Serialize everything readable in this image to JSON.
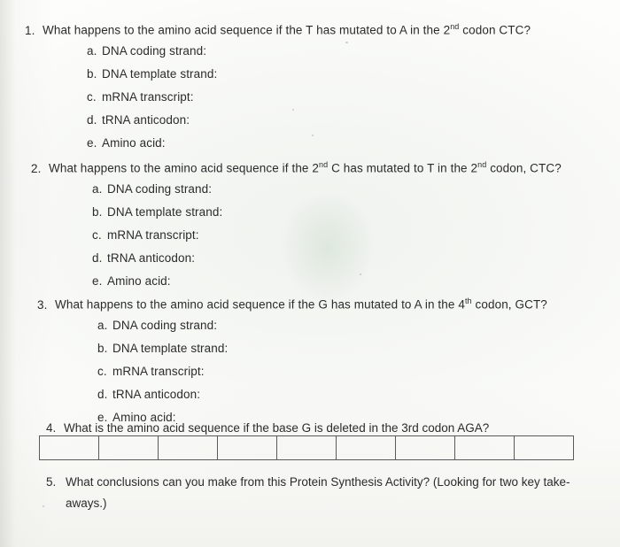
{
  "document": {
    "questions": [
      {
        "number": "1.",
        "text_parts": {
          "before": "What happens to the amino acid sequence if the T has mutated to A in the 2",
          "sup": "nd",
          "after": " codon CTC?"
        },
        "subitems": [
          {
            "letter": "a.",
            "label": "DNA coding strand:"
          },
          {
            "letter": "b.",
            "label": "DNA template strand:"
          },
          {
            "letter": "c.",
            "label": "mRNA transcript:"
          },
          {
            "letter": "d.",
            "label": "tRNA anticodon:"
          },
          {
            "letter": "e.",
            "label": "Amino acid:"
          }
        ]
      },
      {
        "number": "2.",
        "text_parts": {
          "before": "What happens to the amino acid sequence if the 2",
          "sup": "nd",
          "middle": " C has mutated to T in the 2",
          "sup2": "nd",
          "after": " codon, CTC?"
        },
        "subitems": [
          {
            "letter": "a.",
            "label": "DNA coding strand:"
          },
          {
            "letter": "b.",
            "label": "DNA template strand:"
          },
          {
            "letter": "c.",
            "label": "mRNA transcript:"
          },
          {
            "letter": "d.",
            "label": "tRNA anticodon:"
          },
          {
            "letter": "e.",
            "label": "Amino acid:"
          }
        ]
      },
      {
        "number": "3.",
        "text_parts": {
          "before": "What happens to the amino acid sequence if the G has mutated to A in the 4",
          "sup": "th",
          "after": " codon, GCT?"
        },
        "subitems": [
          {
            "letter": "a.",
            "label": "DNA coding strand:"
          },
          {
            "letter": "b.",
            "label": "DNA template strand:"
          },
          {
            "letter": "c.",
            "label": "mRNA transcript:"
          },
          {
            "letter": "d.",
            "label": "tRNA anticodon:"
          },
          {
            "letter": "e.",
            "label": "Amino acid:"
          }
        ]
      },
      {
        "number": "4.",
        "text": "What is the amino acid sequence if the base G is deleted in the 3rd codon AGA?",
        "answer_cells": [
          "",
          "",
          "",
          "",
          "",
          "",
          "",
          "",
          "",
          ""
        ]
      },
      {
        "number": "5.",
        "line1": "What conclusions can you make from this Protein Synthesis Activity? (Looking for two key take-",
        "line2": "aways.)"
      }
    ]
  }
}
